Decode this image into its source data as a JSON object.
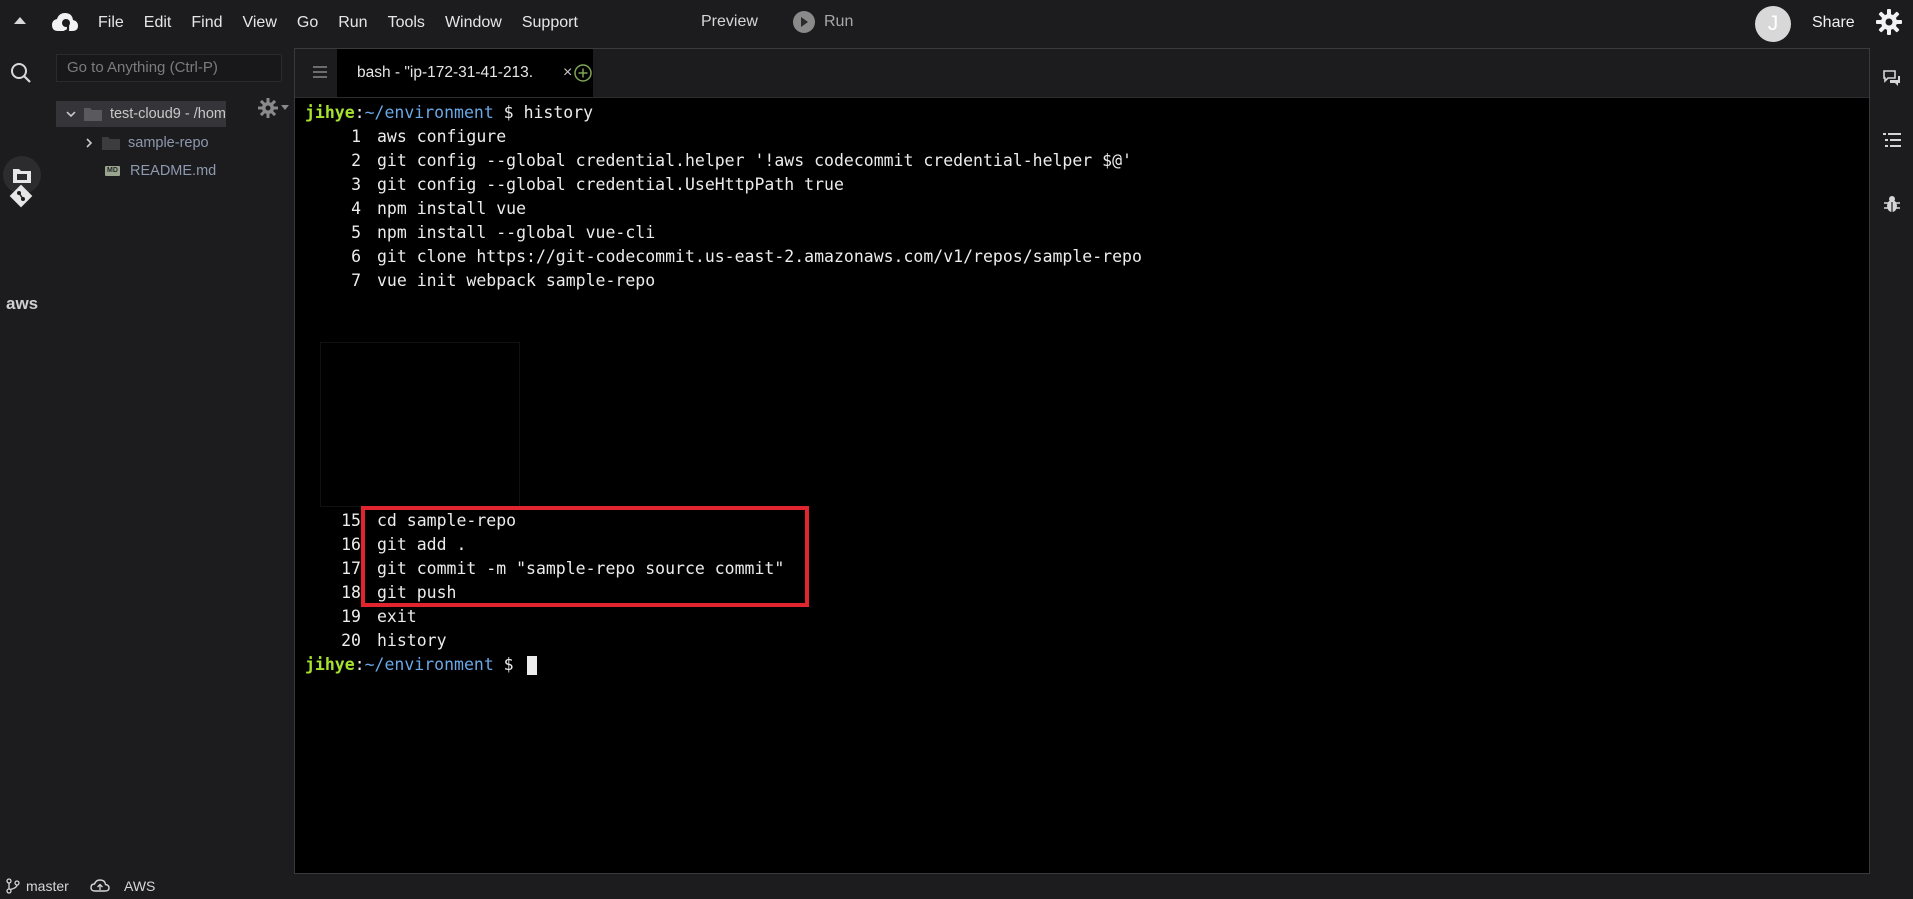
{
  "menubar": {
    "items": [
      "File",
      "Edit",
      "Find",
      "View",
      "Go",
      "Run",
      "Tools",
      "Window",
      "Support"
    ],
    "preview_label": "Preview",
    "run_label": "Run",
    "avatar_initial": "J",
    "share_label": "Share"
  },
  "sidebar": {
    "goto_placeholder": "Go to Anything (Ctrl-P)",
    "tree": {
      "root_label": "test-cloud9 - /hom",
      "child_folder": "sample-repo",
      "child_file": "README.md",
      "file_badge": "MD"
    },
    "rail_aws_label": "aws"
  },
  "editor": {
    "tab_title": "bash - \"ip-172-31-41-213.",
    "tab_close": "×",
    "terminal": {
      "user": "jihye",
      "sep": ":",
      "path": "~/environment",
      "prompt_suffix": " $ ",
      "command": "history",
      "history": [
        {
          "num": "1",
          "cmd": "aws configure"
        },
        {
          "num": "2",
          "cmd": "git config --global credential.helper '!aws codecommit credential-helper $@'"
        },
        {
          "num": "3",
          "cmd": "git config --global credential.UseHttpPath true"
        },
        {
          "num": "4",
          "cmd": "npm install vue"
        },
        {
          "num": "5",
          "cmd": "npm install --global vue-cli"
        },
        {
          "num": "6",
          "cmd": "git clone https://git-codecommit.us-east-2.amazonaws.com/v1/repos/sample-repo"
        },
        {
          "num": "7",
          "cmd": "vue init webpack sample-repo"
        },
        {
          "num": "15",
          "cmd": "cd sample-repo"
        },
        {
          "num": "16",
          "cmd": "git add ."
        },
        {
          "num": "17",
          "cmd": "git commit -m \"sample-repo source commit\""
        },
        {
          "num": "18",
          "cmd": "git push"
        },
        {
          "num": "19",
          "cmd": "exit"
        },
        {
          "num": "20",
          "cmd": "history"
        }
      ],
      "final_prompt_suffix": " $ "
    }
  },
  "statusbar": {
    "branch": "master",
    "aws_label": "AWS"
  },
  "colors": {
    "user": "#a6e22e",
    "path": "#6aa8e6",
    "highlight": "#e1242d",
    "background": "#1c1c1e",
    "terminal_bg": "#000000"
  }
}
